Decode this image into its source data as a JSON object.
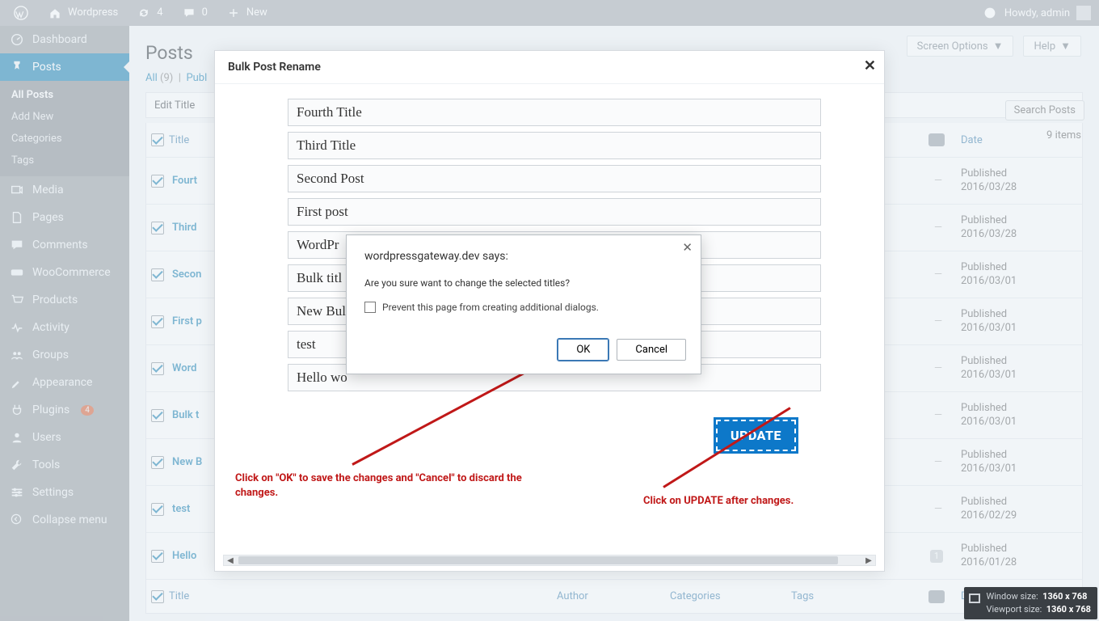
{
  "adminbar": {
    "site": "Wordpress",
    "updates": "4",
    "comments": "0",
    "new": "New",
    "howdy": "Howdy, admin"
  },
  "sidebar": {
    "items": [
      {
        "label": "Dashboard",
        "icon": "dashboard"
      },
      {
        "label": "Posts",
        "icon": "pin",
        "current": true
      },
      {
        "label": "Media",
        "icon": "media"
      },
      {
        "label": "Pages",
        "icon": "page"
      },
      {
        "label": "Comments",
        "icon": "comment"
      },
      {
        "label": "WooCommerce",
        "icon": "woo"
      },
      {
        "label": "Products",
        "icon": "cart"
      },
      {
        "label": "Activity",
        "icon": "activity"
      },
      {
        "label": "Groups",
        "icon": "groups"
      },
      {
        "label": "Appearance",
        "icon": "brush"
      },
      {
        "label": "Plugins",
        "icon": "plugin",
        "badge": "4"
      },
      {
        "label": "Users",
        "icon": "user"
      },
      {
        "label": "Tools",
        "icon": "tool"
      },
      {
        "label": "Settings",
        "icon": "settings"
      }
    ],
    "submenu": [
      "All Posts",
      "Add New",
      "Categories",
      "Tags"
    ],
    "collapse": "Collapse menu"
  },
  "header": {
    "screenOptions": "Screen Options",
    "help": "Help",
    "title": "Posts",
    "allLabel": "All",
    "allCount": "(9)",
    "publishedLabel": "Publ",
    "search": "Search Posts",
    "items": "9 items",
    "editTitle": "Edit Title"
  },
  "columns": {
    "title": "Title",
    "author": "Author",
    "categories": "Categories",
    "tags": "Tags",
    "date": "Date"
  },
  "posts": [
    {
      "title": "Fourt",
      "status": "Published",
      "date": "2016/03/28",
      "c": ""
    },
    {
      "title": "Third",
      "status": "Published",
      "date": "2016/03/28",
      "c": ""
    },
    {
      "title": "Secon",
      "status": "Published",
      "date": "2016/03/01",
      "c": ""
    },
    {
      "title": "First p",
      "status": "Published",
      "date": "2016/03/01",
      "c": ""
    },
    {
      "title": "Word",
      "status": "Published",
      "date": "2016/03/01",
      "c": ""
    },
    {
      "title": "Bulk t",
      "status": "Published",
      "date": "2016/03/01",
      "c": ""
    },
    {
      "title": "New B",
      "status": "Published",
      "date": "2016/03/01",
      "c": ""
    },
    {
      "title": "test",
      "status": "Published",
      "date": "2016/02/29",
      "c": ""
    },
    {
      "title": "Hello",
      "status": "Published",
      "date": "2016/01/28",
      "c": "1"
    }
  ],
  "modal": {
    "title": "Bulk Post Rename",
    "inputs": [
      "Fourth Title",
      "Third Title",
      "Second Post",
      "First post",
      "WordPr",
      "Bulk titl",
      "New Bul",
      "test",
      "Hello wo"
    ],
    "update": "UPDATE",
    "anno1": "Click on \"OK\" to save the changes and \"Cancel\" to discard the changes.",
    "anno2": "Click on UPDATE after changes."
  },
  "dialog": {
    "origin": "wordpressgateway.dev says:",
    "message": "Are you sure want to change the selected titles?",
    "prevent": "Prevent this page from creating additional dialogs.",
    "ok": "OK",
    "cancel": "Cancel"
  },
  "sizebadge": {
    "l1a": "Window size:",
    "l1b": "1360 x 768",
    "l2a": "Viewport size:",
    "l2b": "1360 x 768"
  }
}
